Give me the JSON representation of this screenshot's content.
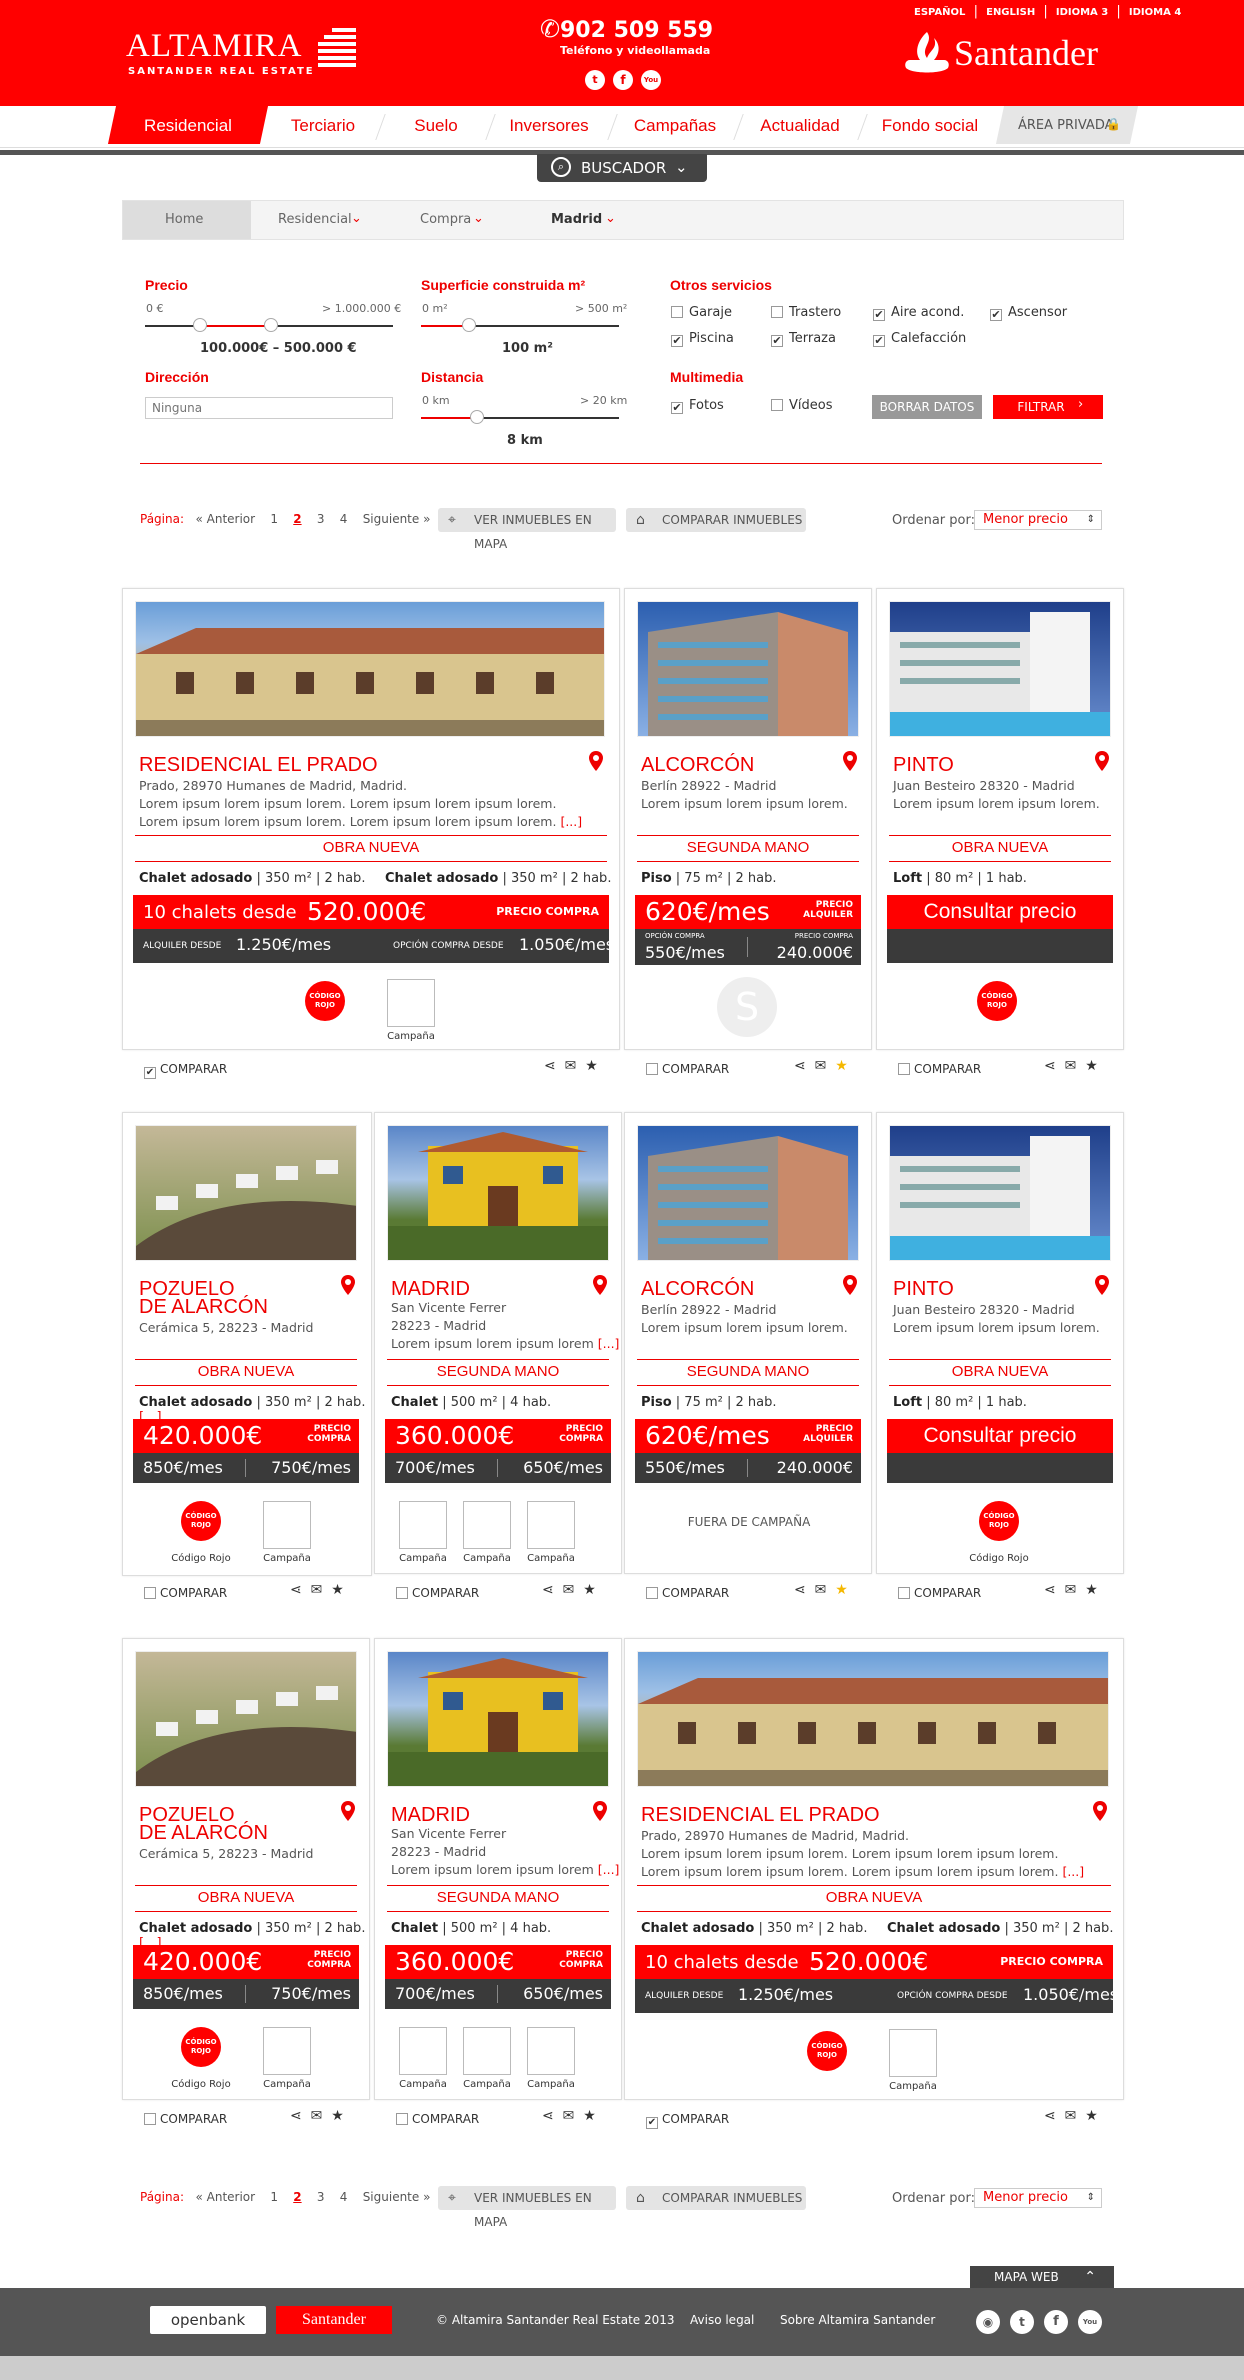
{
  "header": {
    "brand": "ALTAMIRA",
    "brand_sub": "SANTANDER REAL ESTATE",
    "phone": "902 509 559",
    "phone_sub": "Teléfono y videollamada",
    "bank": "Santander",
    "langs": [
      "ESPAÑOL",
      "ENGLISH",
      "IDIOMA 3",
      "IDIOMA 4"
    ]
  },
  "nav": {
    "items": [
      "Residencial",
      "Terciario",
      "Suelo",
      "Inversores",
      "Campañas",
      "Actualidad",
      "Fondo social"
    ],
    "private": "ÁREA PRIVADA"
  },
  "search": {
    "label": "BUSCADOR"
  },
  "breadcrumb": [
    "Home",
    "Residencial",
    "Compra",
    "Madrid"
  ],
  "filters": {
    "price": {
      "label": "Precio",
      "min": "0 €",
      "max": "> 1.000.000 €",
      "value": "100.000€ – 500.000 €"
    },
    "surface": {
      "label": "Superficie construida m²",
      "min": "0 m²",
      "max": "> 500 m²",
      "value": "100 m²"
    },
    "address": {
      "label": "Dirección",
      "placeholder": "Ninguna"
    },
    "distance": {
      "label": "Distancia",
      "min": "0 km",
      "max": "> 20 km",
      "value": "8 km"
    },
    "services": {
      "label": "Otros servicios",
      "items": [
        [
          "Garaje",
          false
        ],
        [
          "Trastero",
          false
        ],
        [
          "Aire acond.",
          true
        ],
        [
          "Ascensor",
          true
        ],
        [
          "Piscina",
          true
        ],
        [
          "Terraza",
          true
        ],
        [
          "Calefacción",
          true
        ]
      ]
    },
    "multimedia": {
      "label": "Multimedia",
      "items": [
        [
          "Fotos",
          true
        ],
        [
          "Vídeos",
          false
        ]
      ]
    },
    "clear": "BORRAR DATOS",
    "filter": "FILTRAR"
  },
  "pager": {
    "label": "Página:",
    "prev": "« Anterior",
    "pages": [
      "1",
      "2",
      "3",
      "4"
    ],
    "current": "2",
    "next": "Siguiente »",
    "map": "VER INMUEBLES EN MAPA",
    "compare": "COMPARAR INMUEBLES",
    "order_label": "Ordenar por:",
    "order_value": "Menor precio"
  },
  "common": {
    "compare": "COMPARAR",
    "campaign": "Campaña",
    "codigo_rojo": "Código Rojo",
    "fuera": "FUERA DE CAMPAÑA",
    "consult": "Consultar precio",
    "lorem2": "Lorem ipsum lorem ipsum lorem. Lorem ipsum lorem ipsum lorem.",
    "lorem1": "Lorem ipsum lorem ipsum lorem.",
    "lorem_short": "Lorem ipsum lorem ipsum lorem",
    "more": "[...]",
    "badge_line1": "CÓDIGO",
    "badge_line2": "ROJO",
    "santander_mark": "S"
  },
  "cards": {
    "prado": {
      "title": "RESIDENCIAL EL PRADO",
      "addr": "Prado, 28970 Humanes de Madrid, Madrid.",
      "status": "OBRA NUEVA",
      "spec1": "Chalet adosado",
      "spec_rest": " | 350 m² | 2 hab.",
      "price_pre": "10 chalets desde",
      "price": "520.000€",
      "price_tag": "PRECIO COMPRA",
      "rent_pre": "ALQUILER DESDE",
      "rent": "1.250€/mes",
      "opt_pre": "OPCIÓN COMPRA DESDE",
      "opt": "1.050€/mes"
    },
    "alcorcon": {
      "title": "ALCORCÓN",
      "addr": "Berlín 28922 - Madrid",
      "status": "SEGUNDA MANO",
      "spec1": "Piso",
      "spec_rest": " | 75 m² | 2 hab.",
      "price": "620€/mes",
      "tag1": "PRECIO",
      "tag2": "ALQUILER",
      "opt_l": "OPCIÓN COMPRA",
      "opt_lv": "550€/mes",
      "opt_r": "PRECIO COMPRA",
      "opt_rv": "240.000€",
      "sub_l": "550€/mes",
      "sub_r": "240.000€"
    },
    "pinto": {
      "title": "PINTO",
      "addr": "Juan Besteiro 28320 - Madrid",
      "status": "OBRA NUEVA",
      "spec1": "Loft",
      "spec_rest": " | 80 m² | 1 hab."
    },
    "pozuelo": {
      "title1": "POZUELO",
      "title2": "DE ALARCÓN",
      "addr": "Cerámica 5, 28223 - Madrid",
      "status": "OBRA NUEVA",
      "spec1": "Chalet adosado",
      "spec_rest": " | 350 m² | 2 hab.",
      "price": "420.000€",
      "tag1": "PRECIO",
      "tag2": "COMPRA",
      "sub_l": "850€/mes",
      "sub_r": "750€/mes"
    },
    "madrid": {
      "title": "MADRID",
      "addr1": "San Vicente Ferrer",
      "addr2": "28223 - Madrid",
      "status": "SEGUNDA MANO",
      "spec1": "Chalet",
      "spec_rest": " | 500 m² | 4 hab.",
      "price": "360.000€",
      "tag1": "PRECIO",
      "tag2": "COMPRA",
      "sub_l": "700€/mes",
      "sub_r": "650€/mes"
    }
  },
  "footer": {
    "mapa": "MAPA WEB",
    "openbank": "openbank",
    "santander": "Santander",
    "copy": "© Altamira Santander Real Estate 2013",
    "legal": "Aviso legal",
    "about": "Sobre Altamira Santander"
  },
  "colors": {
    "brand": "#ff0000",
    "dark": "#3a3a3a",
    "star": "#f5b800"
  }
}
